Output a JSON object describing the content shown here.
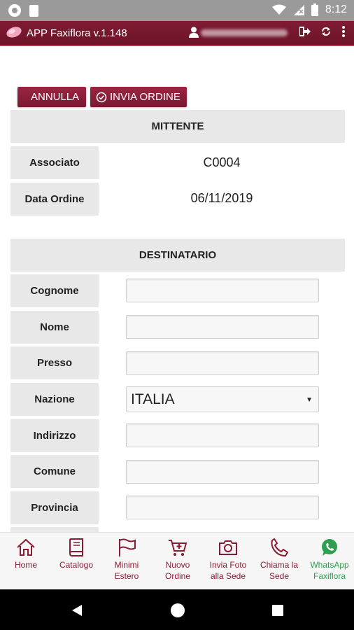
{
  "status_bar": {
    "time": "8:12"
  },
  "app_bar": {
    "title": "APP Faxiflora v.1.148"
  },
  "actions": {
    "cancel_label": "ANNULLA",
    "send_label": "INVIA ORDINE"
  },
  "mittente": {
    "heading": "MITTENTE",
    "rows": [
      {
        "label": "Associato",
        "value": "C0004"
      },
      {
        "label": "Data Ordine",
        "value": "06/11/2019"
      }
    ]
  },
  "destinatario": {
    "heading": "DESTINATARIO",
    "fields": [
      {
        "label": "Cognome",
        "value": ""
      },
      {
        "label": "Nome",
        "value": ""
      },
      {
        "label": "Presso",
        "value": ""
      },
      {
        "label": "Nazione",
        "value": "ITALIA"
      },
      {
        "label": "Indirizzo",
        "value": ""
      },
      {
        "label": "Comune",
        "value": ""
      },
      {
        "label": "Provincia",
        "value": ""
      }
    ]
  },
  "bottom_nav": {
    "items": [
      {
        "label": "Home",
        "icon": "home-icon"
      },
      {
        "label": "Catalogo",
        "icon": "book-icon"
      },
      {
        "label": "Minimi Estero",
        "icon": "flag-icon"
      },
      {
        "label": "Nuovo Ordine",
        "icon": "cart-icon"
      },
      {
        "label": "Invia Foto alla Sede",
        "icon": "camera-icon"
      },
      {
        "label": "Chiama la Sede",
        "icon": "phone-icon"
      },
      {
        "label": "WhatsApp Faxiflora",
        "icon": "whatsapp-icon"
      }
    ]
  },
  "colors": {
    "brand": "#7b1832",
    "whatsapp": "#2e9e4f",
    "cell_bg": "#e8e8e8"
  }
}
